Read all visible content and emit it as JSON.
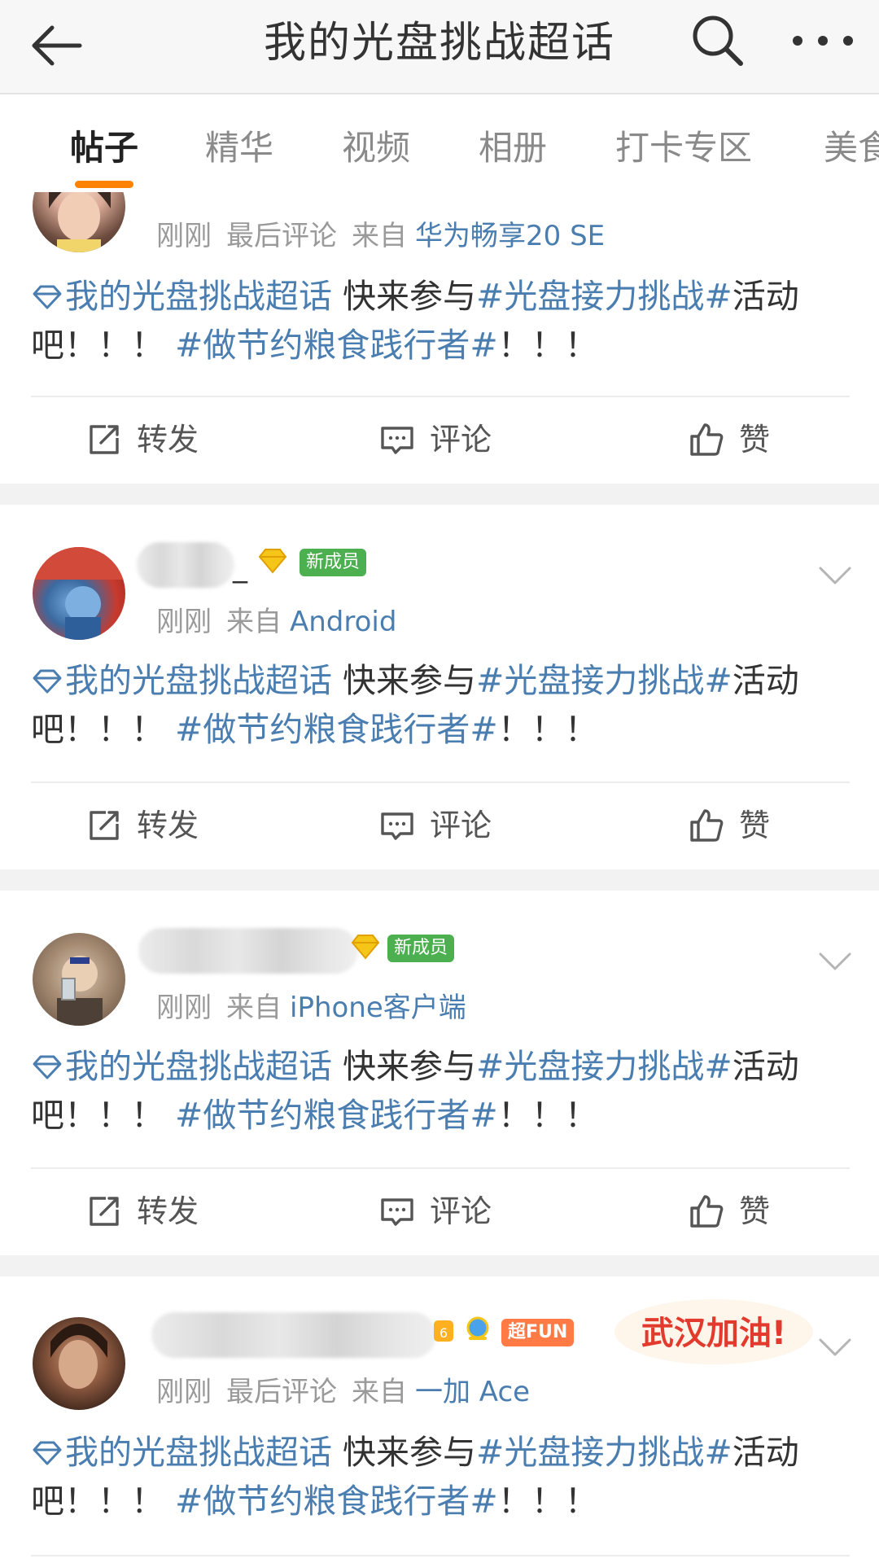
{
  "header": {
    "title": "我的光盘挑战超话"
  },
  "tabs": [
    "帖子",
    "精华",
    "视频",
    "相册",
    "打卡专区",
    "美食"
  ],
  "colors": {
    "accent": "#ff8200",
    "link": "#4b7eb0",
    "badge_new": "#4caf50",
    "badge_fun": "#ff7a45"
  },
  "post_content": {
    "topic": "我的光盘挑战超话",
    "text1": " 快来参与",
    "tag1": "#光盘接力挑战#",
    "text2": "活动吧！！！ ",
    "tag2": "#做节约粮食践行者#",
    "text3": "！！！"
  },
  "actions": {
    "repost": "转发",
    "comment": "评论",
    "like": "赞"
  },
  "posts": [
    {
      "meta_time": "刚刚",
      "meta_extra": "最后评论",
      "meta_from": "来自",
      "meta_source": "华为畅享20 SE"
    },
    {
      "name_suffix": "_",
      "badge": "新成员",
      "meta_time": "刚刚",
      "meta_from": "来自",
      "meta_source": "Android"
    },
    {
      "badge": "新成员",
      "meta_time": "刚刚",
      "meta_from": "来自",
      "meta_source": "iPhone客户端"
    },
    {
      "badge": "超FUN",
      "sticker": "武汉加油!",
      "meta_time": "刚刚",
      "meta_extra": "最后评论",
      "meta_from": "来自",
      "meta_source": "一加 Ace"
    }
  ]
}
